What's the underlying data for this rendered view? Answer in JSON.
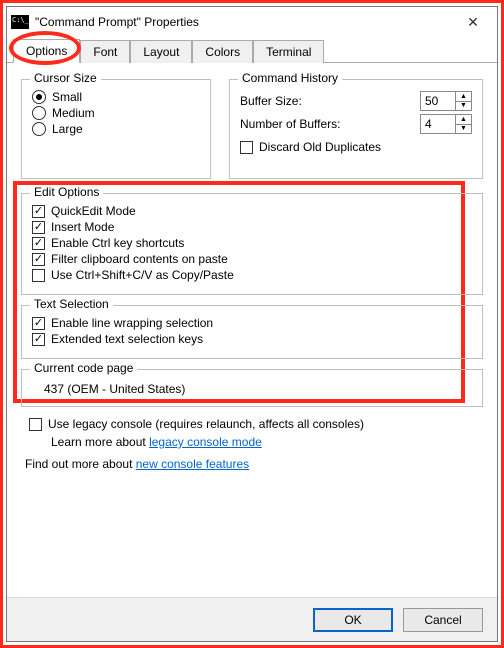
{
  "window": {
    "title": "\"Command Prompt\" Properties",
    "close": "✕"
  },
  "tabs": {
    "items": [
      "Options",
      "Font",
      "Layout",
      "Colors",
      "Terminal"
    ],
    "active": 0
  },
  "cursor": {
    "title": "Cursor Size",
    "options": [
      "Small",
      "Medium",
      "Large"
    ],
    "selected": 0
  },
  "history": {
    "title": "Command History",
    "buffer_label": "Buffer Size:",
    "buffer_value": "50",
    "num_label": "Number of Buffers:",
    "num_value": "4",
    "discard_label": "Discard Old Duplicates",
    "discard_checked": false
  },
  "edit": {
    "title": "Edit Options",
    "items": [
      {
        "label": "QuickEdit Mode",
        "checked": true
      },
      {
        "label": "Insert Mode",
        "checked": true
      },
      {
        "label": "Enable Ctrl key shortcuts",
        "checked": true
      },
      {
        "label": "Filter clipboard contents on paste",
        "checked": true
      },
      {
        "label": "Use Ctrl+Shift+C/V as Copy/Paste",
        "checked": false
      }
    ]
  },
  "textsel": {
    "title": "Text Selection",
    "items": [
      {
        "label": "Enable line wrapping selection",
        "checked": true
      },
      {
        "label": "Extended text selection keys",
        "checked": true
      }
    ]
  },
  "codepage": {
    "title": "Current code page",
    "value": "437   (OEM - United States)"
  },
  "legacy": {
    "checkbox_label": "Use legacy console (requires relaunch, affects all consoles)",
    "checked": false,
    "learn_prefix": "Learn more about ",
    "learn_link": "legacy console mode"
  },
  "findout": {
    "prefix": "Find out more about ",
    "link": "new console features"
  },
  "buttons": {
    "ok": "OK",
    "cancel": "Cancel"
  }
}
